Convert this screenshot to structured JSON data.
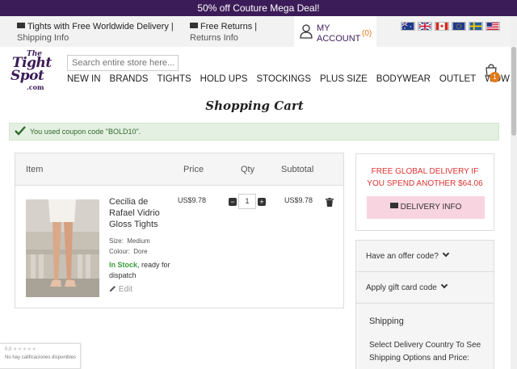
{
  "promo": {
    "text": "50% off Couture Mega Deal!"
  },
  "info_strip": {
    "delivery_lead": "Tights with Free Worldwide Delivery |",
    "delivery_sub": "Shipping Info",
    "returns_lead": "Free Returns |",
    "returns_sub": "Returns Info"
  },
  "account": {
    "label_line1": "MY",
    "label_line2": "ACCOUNT",
    "count": "(0)"
  },
  "flags": [
    "AU",
    "UK",
    "CA",
    "EU",
    "SE",
    "US"
  ],
  "logo": {
    "line1": "The",
    "line2": "Tight",
    "line3": "Spot",
    "line4": ".com"
  },
  "search": {
    "placeholder": "Search entire store here..."
  },
  "nav": [
    "NEW IN",
    "BRANDS",
    "TIGHTS",
    "HOLD UPS",
    "STOCKINGS",
    "PLUS SIZE",
    "BODYWEAR",
    "OUTLET",
    "WOW!"
  ],
  "cart_badge": "1",
  "page_title": "Shopping Cart",
  "notice": {
    "message": "You used coupon code \"BOLD10\"."
  },
  "cart_table": {
    "headers": {
      "item": "Item",
      "price": "Price",
      "qty": "Qty",
      "subtotal": "Subtotal"
    },
    "item": {
      "name": "Cecilia de Rafael Vidrio Gloss Tights",
      "size_label": "Size:",
      "size_value": "Medium",
      "colour_label": "Colour:",
      "colour_value": "Dore",
      "stock_status": "In Stock",
      "stock_rest": ", ready for dispatch",
      "edit": "Edit",
      "price": "US$9.78",
      "qty": "1",
      "subtotal": "US$9.78"
    }
  },
  "delivery": {
    "line1": "FREE GLOBAL DELIVERY IF",
    "line2": "YOU SPEND ANOTHER $64.06",
    "button": "DELIVERY INFO"
  },
  "side_panel": {
    "offer_code": "Have an offer code?",
    "gift_card": "Apply gift card code",
    "shipping_title": "Shipping",
    "shipping_desc": "Select Delivery Country To See Shipping Options and Price:"
  },
  "rating_widget": {
    "score": "0,0",
    "text": "No hay calificaciones disponibles"
  },
  "colors": {
    "brand": "#3c1c58",
    "accent": "#e07b1a",
    "alert": "#dd3333",
    "pink_button": "#f8d4e0",
    "success": "#3a9d3a"
  }
}
